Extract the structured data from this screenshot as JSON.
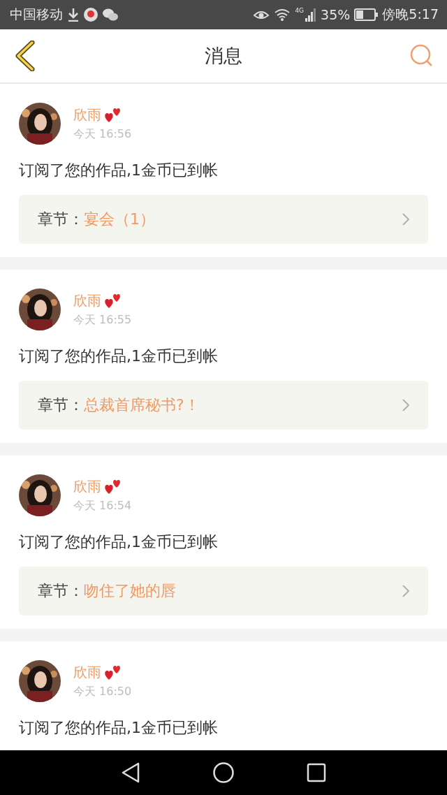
{
  "status_bar": {
    "carrier": "中国移动",
    "network": "4G",
    "battery": "35%",
    "time": "傍晚5:17"
  },
  "header": {
    "title": "消息"
  },
  "messages": [
    {
      "name": "欣雨",
      "time": "今天 16:56",
      "text": "订阅了您的作品,1金币已到帐",
      "chapter_label": "章节：",
      "chapter": "宴会（1）"
    },
    {
      "name": "欣雨",
      "time": "今天 16:55",
      "text": "订阅了您的作品,1金币已到帐",
      "chapter_label": "章节：",
      "chapter": "总裁首席秘书?！"
    },
    {
      "name": "欣雨",
      "time": "今天 16:54",
      "text": "订阅了您的作品,1金币已到帐",
      "chapter_label": "章节：",
      "chapter": "吻住了她的唇"
    },
    {
      "name": "欣雨",
      "time": "今天 16:50",
      "text": "订阅了您的作品,1金币已到帐"
    }
  ]
}
